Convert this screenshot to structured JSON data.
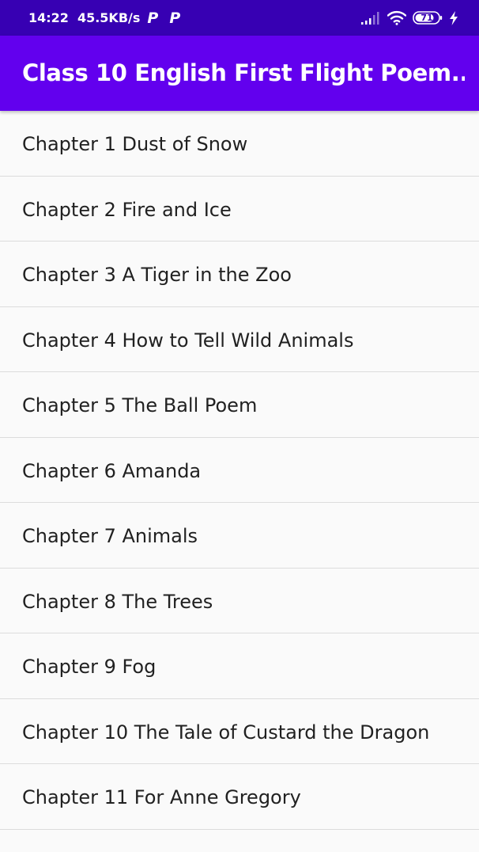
{
  "status_bar": {
    "time": "14:22",
    "network_speed": "45.5KB/s",
    "notification_icons": [
      "P",
      "P"
    ],
    "battery_level": "71",
    "icons": [
      "signal-icon",
      "wifi-icon",
      "battery-icon",
      "charging-bolt-icon"
    ]
  },
  "app_bar": {
    "title": "Class 10 English First Flight Poem..."
  },
  "chapters": [
    "Chapter 1 Dust of Snow",
    "Chapter 2 Fire and Ice",
    "Chapter 3 A Tiger in the Zoo",
    "Chapter 4 How to Tell Wild Animals",
    "Chapter 5 The Ball Poem",
    "Chapter 6 Amanda",
    "Chapter 7 Animals",
    "Chapter 8 The Trees",
    "Chapter 9 Fog",
    "Chapter 10 The Tale of Custard the Dragon",
    "Chapter 11 For Anne Gregory"
  ],
  "colors": {
    "status_bar": "#3700b3",
    "app_bar": "#6200ee",
    "background": "#fafafa",
    "text": "#212121",
    "divider": "#dcdcdc"
  }
}
